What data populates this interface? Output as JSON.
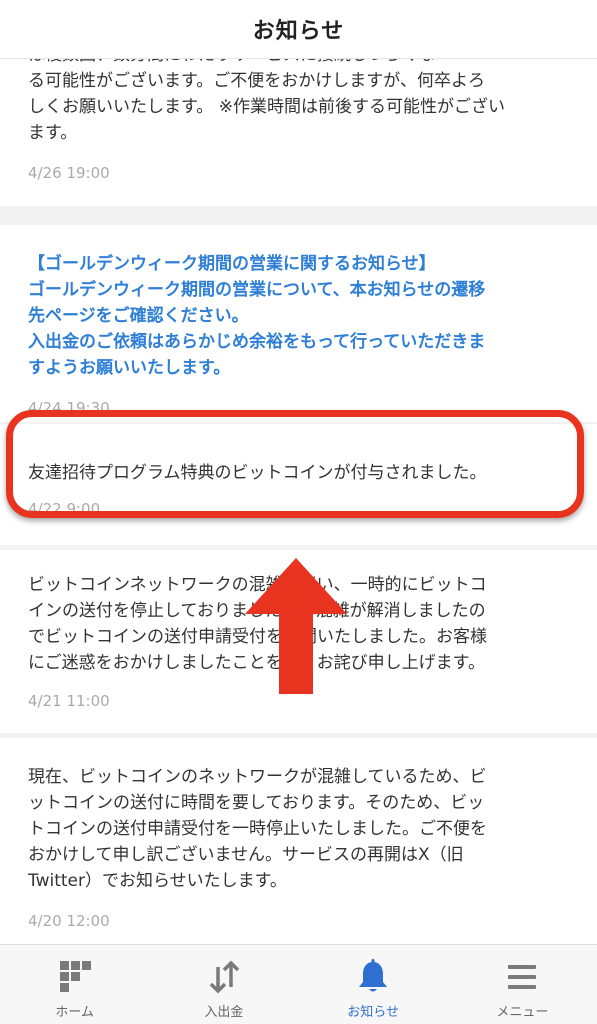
{
  "header": {
    "title": "お知らせ"
  },
  "notices": [
    {
      "lines": [
        "は複数回、数分間にわたりサービスに接続しづらくな",
        "る可能性がございます。ご不便をおかけしますが、何卒よろ",
        "しくお願いいたします。 ※作業時間は前後する可能性がござい",
        "ます。"
      ],
      "date": "4/26 19:00",
      "highlighted_text": false
    },
    {
      "lines": [
        "【ゴールデンウィーク期間の営業に関するお知らせ】",
        "ゴールデンウィーク期間の営業について、本お知らせの遷移",
        "先ページをご確認ください。",
        "入出金のご依頼はあらかじめ余裕をもって行っていただきま",
        "すようお願いいたします。"
      ],
      "date": "4/24 19:30",
      "highlighted_text": true
    },
    {
      "lines": [
        "友達招待プログラム特典のビットコインが付与されました。"
      ],
      "date": "4/22 9:00",
      "highlighted_text": false
    },
    {
      "lines": [
        "ビットコインネットワークの混雑に伴い、一時的にビットコ",
        "インの送付を停止しておりましたが、混雑が解消しましたの",
        "でビットコインの送付申請受付を再開いたしました。お客様",
        "にご迷惑をおかけしましたことを深くお詫び申し上げます。"
      ],
      "date": "4/21 11:00",
      "highlighted_text": false
    },
    {
      "lines": [
        "現在、ビットコインのネットワークが混雑しているため、ビ",
        "ットコインの送付に時間を要しております。そのため、ビッ",
        "トコインの送付申請受付を一時停止いたしました。ご不便を",
        "おかけして申し訳ございません。サービスの再開はX（旧",
        "Twitter）でお知らせいたします。"
      ],
      "date": "4/20 12:00",
      "highlighted_text": false
    }
  ],
  "tabs": [
    {
      "label": "ホーム",
      "icon": "home-grid-icon",
      "active": false
    },
    {
      "label": "入出金",
      "icon": "transfer-arrows-icon",
      "active": false
    },
    {
      "label": "お知らせ",
      "icon": "bell-icon",
      "active": true
    },
    {
      "label": "メニュー",
      "icon": "hamburger-menu-icon",
      "active": false
    }
  ],
  "colors": {
    "accent_blue": "#2f7fd6",
    "active_tab": "#2f6fd0",
    "highlight_red": "#e8341f",
    "date_gray": "#aaaaaa"
  }
}
